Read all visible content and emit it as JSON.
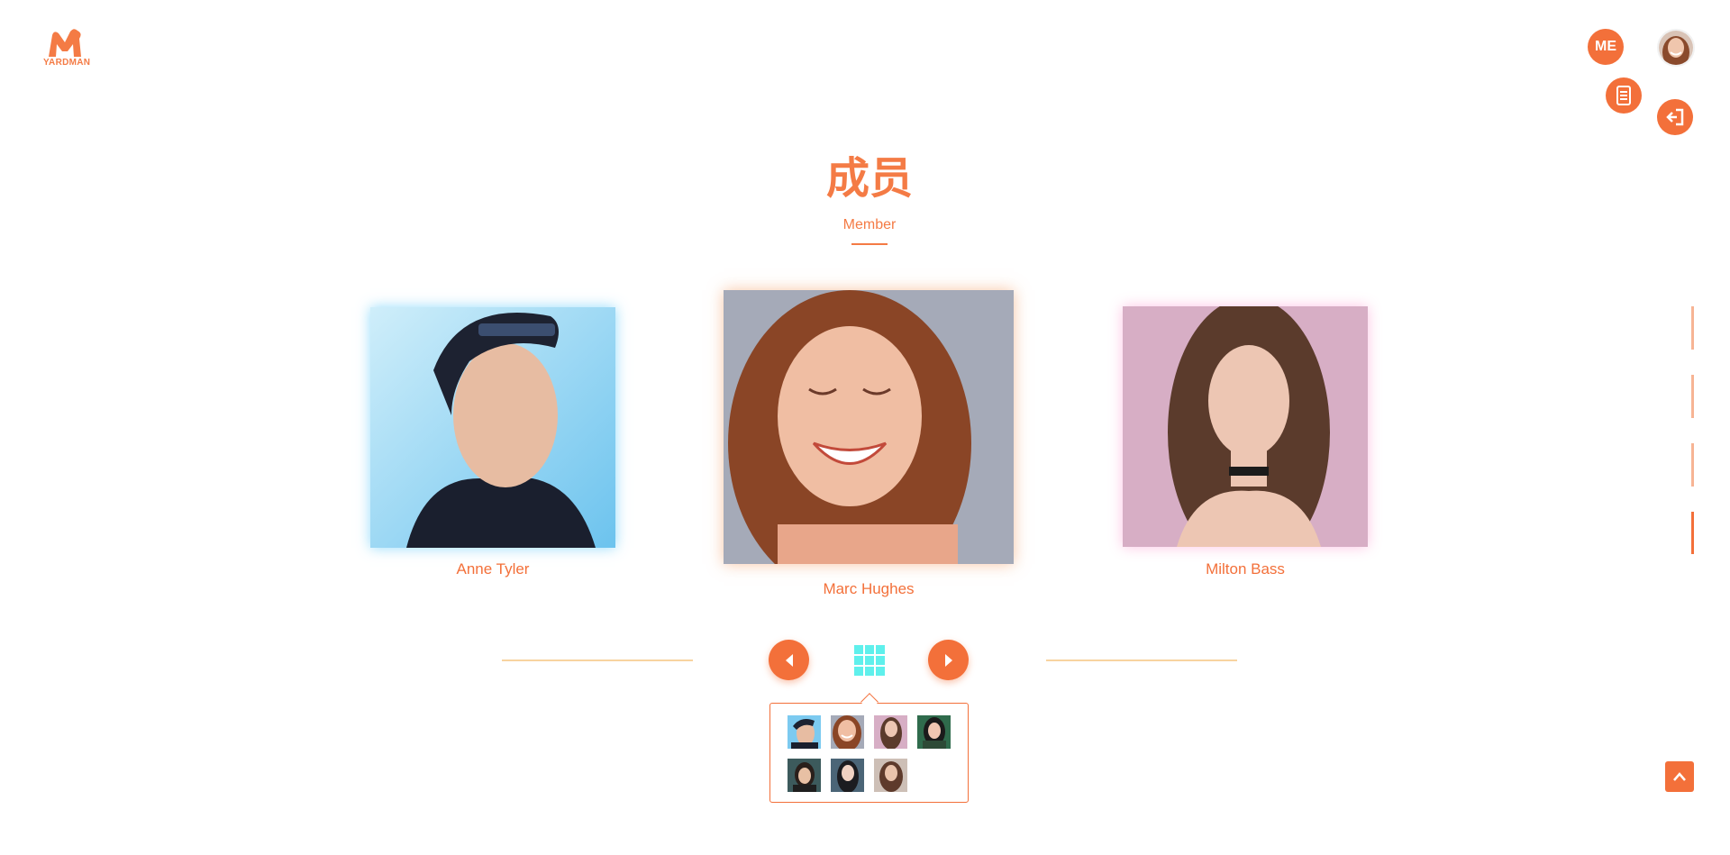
{
  "brand": {
    "name": "YARDMAN",
    "color": "#f47b45",
    "icon": "m-logo-icon"
  },
  "header": {
    "me_label": "ME",
    "profile_icon": "avatar",
    "doc_icon": "document-icon",
    "exit_icon": "logout-icon"
  },
  "section": {
    "title_cn": "成员",
    "title_en": "Member"
  },
  "members": [
    {
      "name": "Anne Tyler",
      "position": "left"
    },
    {
      "name": "Marc Hughes",
      "position": "center"
    },
    {
      "name": "Milton Bass",
      "position": "right"
    }
  ],
  "controls": {
    "prev_icon": "chevron-left-icon",
    "grid_icon": "grid-icon",
    "next_icon": "chevron-right-icon",
    "back_to_top_icon": "chevron-up-icon"
  },
  "thumbnails_count": 7,
  "colors": {
    "accent": "#f3703a",
    "accent_light": "#f7b494",
    "grid": "#5ff0ec",
    "line": "#f8d3a0"
  }
}
